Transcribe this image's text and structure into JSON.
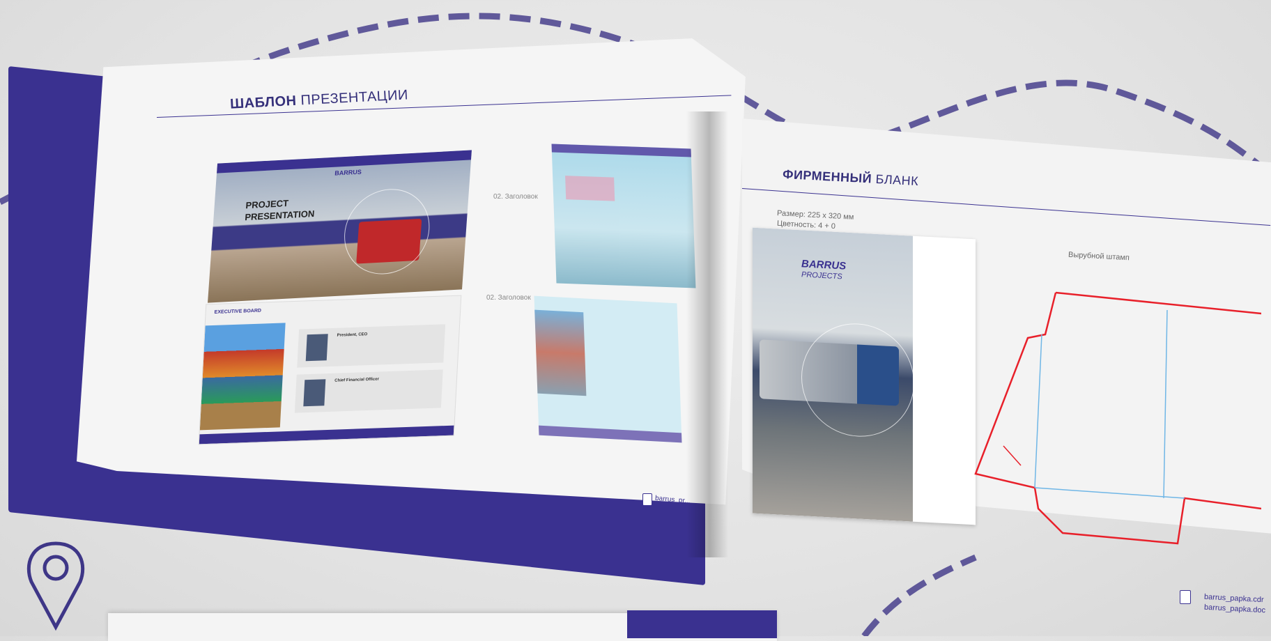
{
  "left_page": {
    "title_bold": "ШАБЛОН",
    "title_light": "ПРЕЗЕНТАЦИИ",
    "slide": {
      "brand": "BARRUS",
      "heading_line1": "PROJECT",
      "heading_line2": "PRESENTATION"
    },
    "slide2": {
      "header": "EXECUTIVE BOARD",
      "person1_title": "President, CEO",
      "person2_title": "Chief Financial Officer"
    },
    "annotations": [
      "02. Заголовок",
      "02. Заголовок"
    ],
    "footer_file": "barrus_pr..."
  },
  "right_page": {
    "title_bold": "ФИРМЕННЫЙ",
    "title_light": "БЛАНК",
    "size": "Размер: 225 x 320 мм",
    "color": "Цветность: 4 + 0",
    "die_label": "Вырубной штамп",
    "brand_line1": "BARRUS",
    "brand_line2": "PROJECTS",
    "footer_file1": "barrus_papka.cdr",
    "footer_file2": "barrus_papka.doc"
  },
  "colors": {
    "brand": "#3a3190",
    "die_line": "#e8202a",
    "fold_line": "#6fb6e6"
  }
}
